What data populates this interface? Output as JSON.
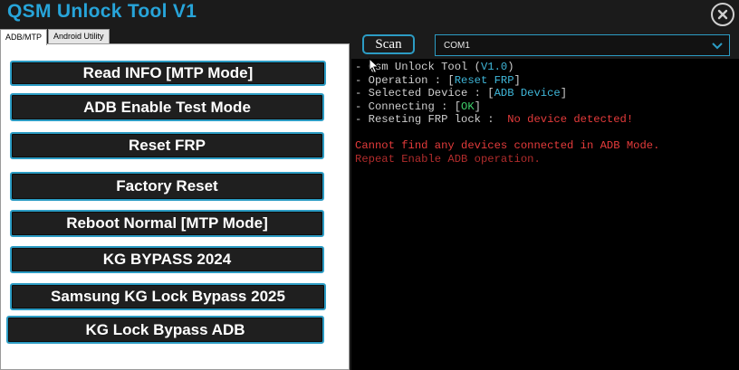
{
  "app": {
    "title": "QSM Unlock Tool V1"
  },
  "tabs": [
    {
      "label": "ADB/MTP",
      "active": true
    },
    {
      "label": "Android Utility",
      "active": false
    }
  ],
  "actions": [
    {
      "label": "Read INFO  [MTP Mode]"
    },
    {
      "label": "ADB Enable Test Mode"
    },
    {
      "label": "Reset FRP"
    },
    {
      "label": "Factory Reset"
    },
    {
      "label": "Reboot Normal [MTP Mode]"
    },
    {
      "label": "KG BYPASS 2024"
    },
    {
      "label": "Samsung KG Lock Bypass 2025"
    },
    {
      "label": "KG Lock Bypass ADB"
    }
  ],
  "toolbar": {
    "scan_label": "Scan",
    "port_value": "COM1"
  },
  "console": {
    "line1": {
      "prefix": "- Qsm Unlock Tool (",
      "value": "V1.0",
      "suffix": ")"
    },
    "line2": {
      "prefix": "- Operation : [",
      "value": "Reset FRP",
      "suffix": "]"
    },
    "line3": {
      "prefix": "- Selected Device : [",
      "value": "ADB Device",
      "suffix": "]"
    },
    "line4": {
      "prefix": "- Connecting : [",
      "value": "OK",
      "suffix": "]"
    },
    "line5": {
      "prefix": "- Reseting FRP lock :  ",
      "value": "No device detected!"
    },
    "error1": "Cannot find any devices connected in ADB Mode.",
    "error2": "Repeat Enable ADB operation."
  },
  "colors": {
    "accent": "#2c9cc4",
    "title": "#27a4d9",
    "value": "#3fb6d8",
    "ok": "#3fcf6a",
    "error": "#e53b3b"
  }
}
